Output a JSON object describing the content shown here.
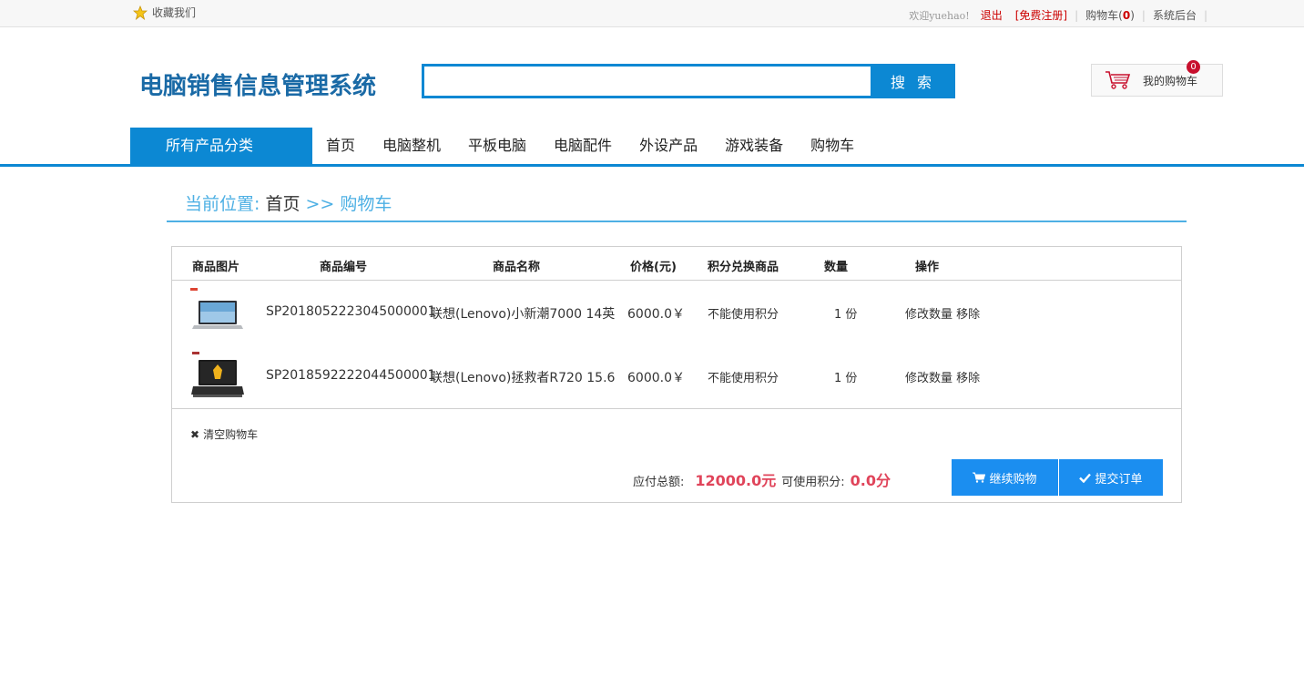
{
  "topbar": {
    "favorite": "收藏我们",
    "welcome_prefix": "欢迎",
    "username": "yuehao",
    "welcome_suffix": "!",
    "logout": "退出",
    "register": "[免费注册]",
    "cart_label": "购物车(",
    "cart_count": "0",
    "cart_close": ")",
    "admin": "系统后台"
  },
  "header": {
    "logo": "电脑销售信息管理系统",
    "search_placeholder": "",
    "search_button": "搜 索",
    "my_cart": "我的购物车",
    "cart_badge": "0"
  },
  "nav": {
    "all_categories": "所有产品分类",
    "items": [
      "首页",
      "电脑整机",
      "平板电脑",
      "电脑配件",
      "外设产品",
      "游戏装备",
      "购物车"
    ]
  },
  "breadcrumb": {
    "label": "当前位置:",
    "home": "首页",
    "current": ">> 购物车"
  },
  "cart": {
    "headers": [
      "商品图片",
      "商品编号",
      "商品名称",
      "价格(元)",
      "积分兑换商品",
      "数量",
      "操作"
    ],
    "rows": [
      {
        "code": "SP2018052223045000001",
        "name": "联想(Lenovo)小新潮7000 14英",
        "price": "6000.0￥",
        "points": "不能使用积分",
        "qty": "1 份",
        "op_modify": "修改数量",
        "op_remove": "移除"
      },
      {
        "code": "SP2018592222044500001",
        "name": "联想(Lenovo)拯救者R720 15.6",
        "price": "6000.0￥",
        "points": "不能使用积分",
        "qty": "1 份",
        "op_modify": "修改数量",
        "op_remove": "移除"
      }
    ],
    "clear": "清空购物车",
    "total_label": "应付总额:",
    "total_amount": "12000.0元",
    "points_label": "可使用积分:",
    "points_value": "0.0分",
    "btn_continue": "继续购物",
    "btn_submit": "提交订单"
  },
  "colors": {
    "brand_blue": "#0c88d3",
    "logo_blue": "#1a6aa6",
    "accent_red": "#e0445a",
    "button_blue": "#1b8ef0"
  }
}
